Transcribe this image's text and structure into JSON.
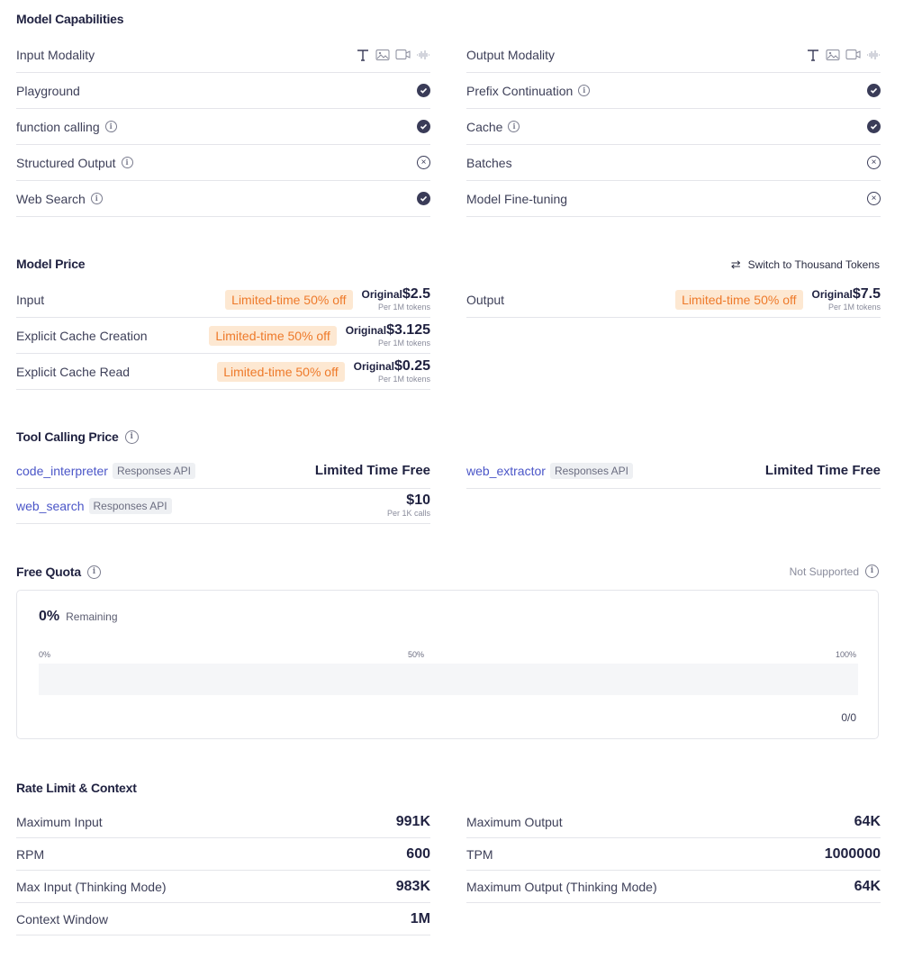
{
  "capabilities": {
    "title": "Model Capabilities",
    "left": [
      {
        "label": "Input Modality",
        "type": "modality",
        "info": false
      },
      {
        "label": "Playground",
        "type": "check",
        "info": false
      },
      {
        "label": "function calling",
        "type": "check",
        "info": true
      },
      {
        "label": "Structured Output",
        "type": "cross",
        "info": true
      },
      {
        "label": "Web Search",
        "type": "check",
        "info": true
      }
    ],
    "right": [
      {
        "label": "Output Modality",
        "type": "modality",
        "info": false
      },
      {
        "label": "Prefix Continuation",
        "type": "check",
        "info": true
      },
      {
        "label": "Cache",
        "type": "check",
        "info": true
      },
      {
        "label": "Batches",
        "type": "cross",
        "info": false
      },
      {
        "label": "Model Fine-tuning",
        "type": "cross",
        "info": false
      }
    ],
    "modality_icons": [
      "text-icon",
      "image-icon",
      "video-icon",
      "audio-icon"
    ]
  },
  "price": {
    "title": "Model Price",
    "switch_label": "Switch to Thousand Tokens",
    "promo": "Limited-time 50% off",
    "original_label": "Original",
    "unit": "Per 1M tokens",
    "left": [
      {
        "label": "Input",
        "value": "$2.5"
      },
      {
        "label": "Explicit Cache Creation",
        "value": "$3.125"
      },
      {
        "label": "Explicit Cache Read",
        "value": "$0.25"
      }
    ],
    "right": [
      {
        "label": "Output",
        "value": "$7.5"
      }
    ]
  },
  "tools": {
    "title": "Tool Calling Price",
    "api_tag": "Responses API",
    "items": [
      {
        "name": "code_interpreter",
        "value": "Limited Time Free"
      },
      {
        "name": "web_extractor",
        "value": "Limited Time Free"
      },
      {
        "name": "web_search",
        "value": "$10",
        "unit": "Per 1K calls"
      }
    ]
  },
  "quota": {
    "title": "Free Quota",
    "status": "Not Supported",
    "percent": "0%",
    "remaining_label": "Remaining",
    "scale": [
      "0%",
      "50%",
      "100%"
    ],
    "fill_fraction": 0,
    "count": "0/0"
  },
  "rate": {
    "title": "Rate Limit & Context",
    "left": [
      {
        "label": "Maximum Input",
        "value": "991K"
      },
      {
        "label": "RPM",
        "value": "600"
      },
      {
        "label": "Max Input (Thinking Mode)",
        "value": "983K"
      },
      {
        "label": "Context Window",
        "value": "1M"
      }
    ],
    "right": [
      {
        "label": "Maximum Output",
        "value": "64K"
      },
      {
        "label": "TPM",
        "value": "1000000"
      },
      {
        "label": "Maximum Output (Thinking Mode)",
        "value": "64K"
      }
    ]
  }
}
